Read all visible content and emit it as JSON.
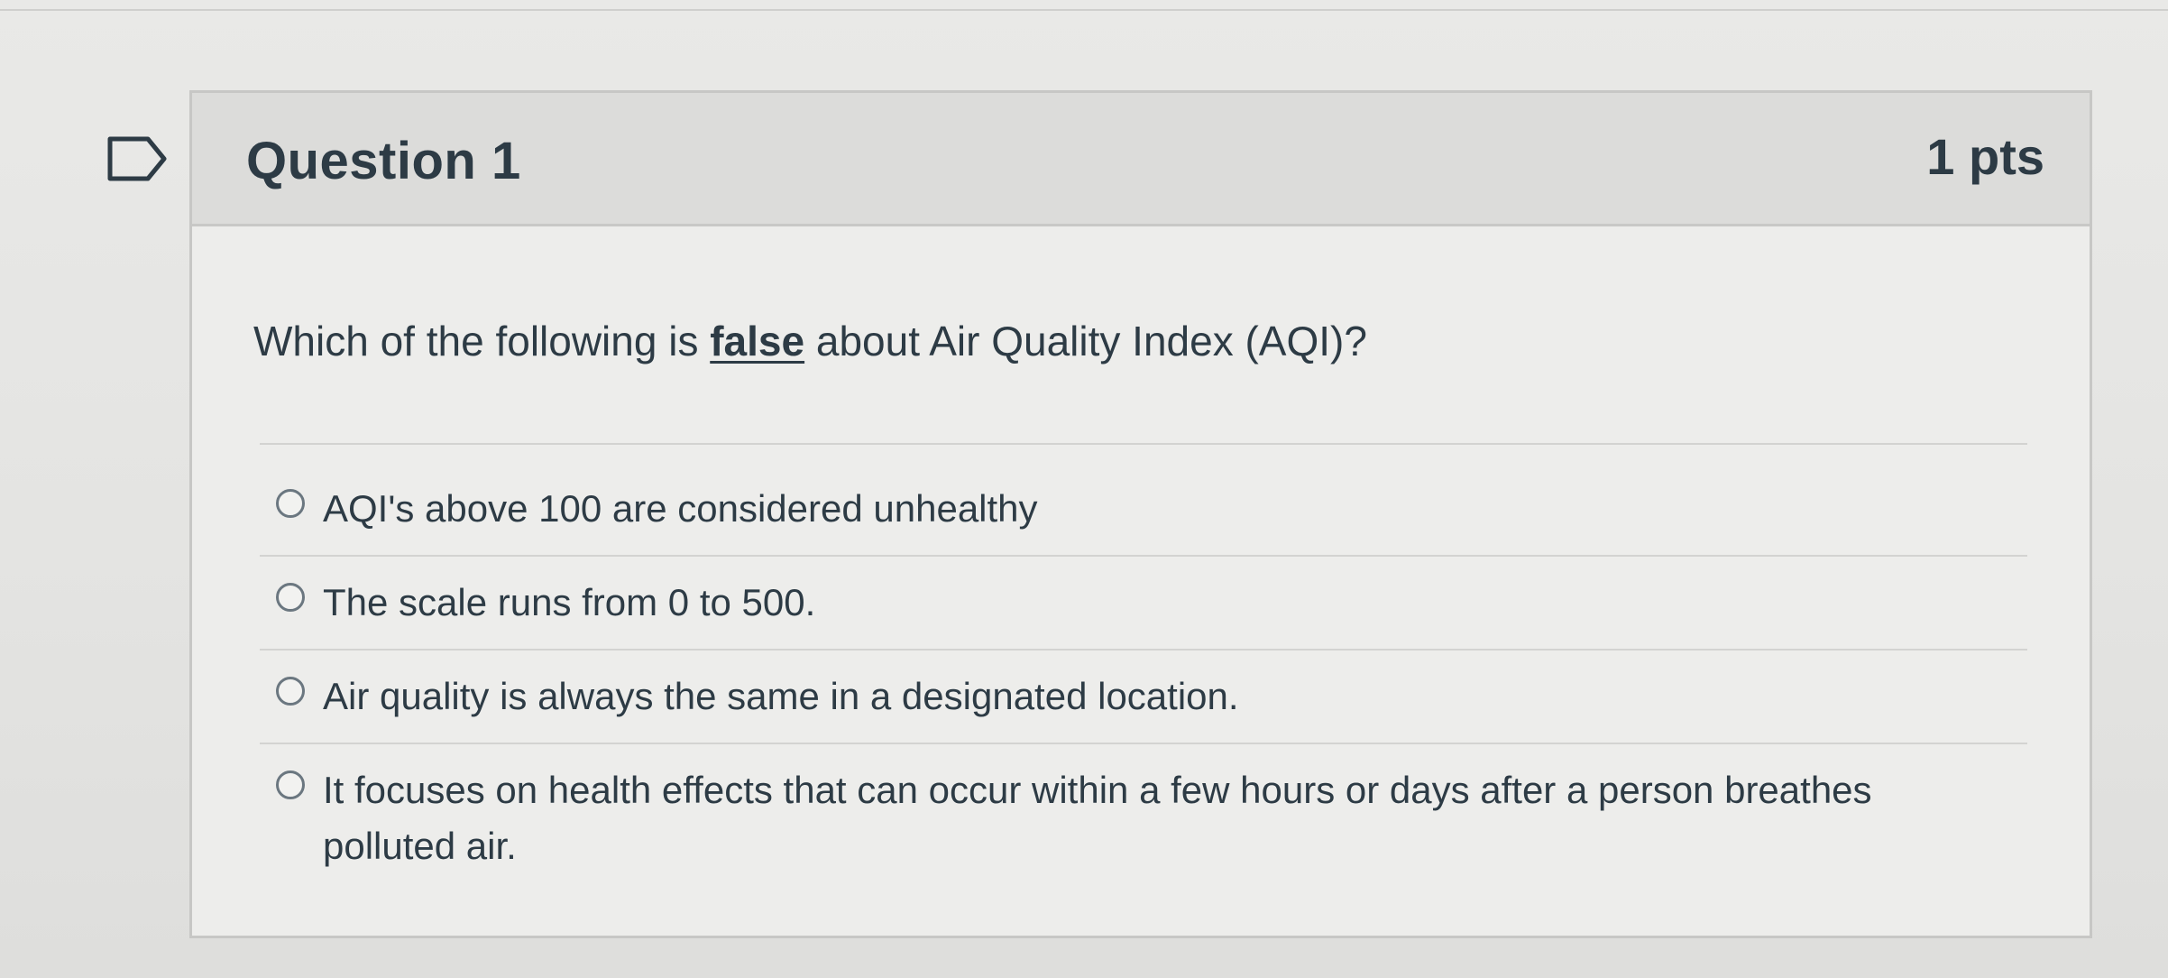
{
  "question": {
    "title": "Question 1",
    "points": "1 pts",
    "text_before": "Which of the following is ",
    "text_emphasis": "false",
    "text_after": " about Air Quality Index (AQI)?"
  },
  "answers": [
    {
      "label": "AQI's above 100 are considered unhealthy",
      "selected": false
    },
    {
      "label": "The scale runs from 0 to 500.",
      "selected": false
    },
    {
      "label": "Air quality is always the same in a designated location.",
      "selected": false
    },
    {
      "label": "It focuses on health effects that can occur within a few hours or days after a person breathes polluted air.",
      "selected": false
    }
  ],
  "icons": {
    "flag": "flag-question-icon",
    "radio": "radio-unselected-icon"
  },
  "colors": {
    "text": "#2d3b45",
    "header_bg": "#dcdcda",
    "border": "#c7c7c5"
  }
}
